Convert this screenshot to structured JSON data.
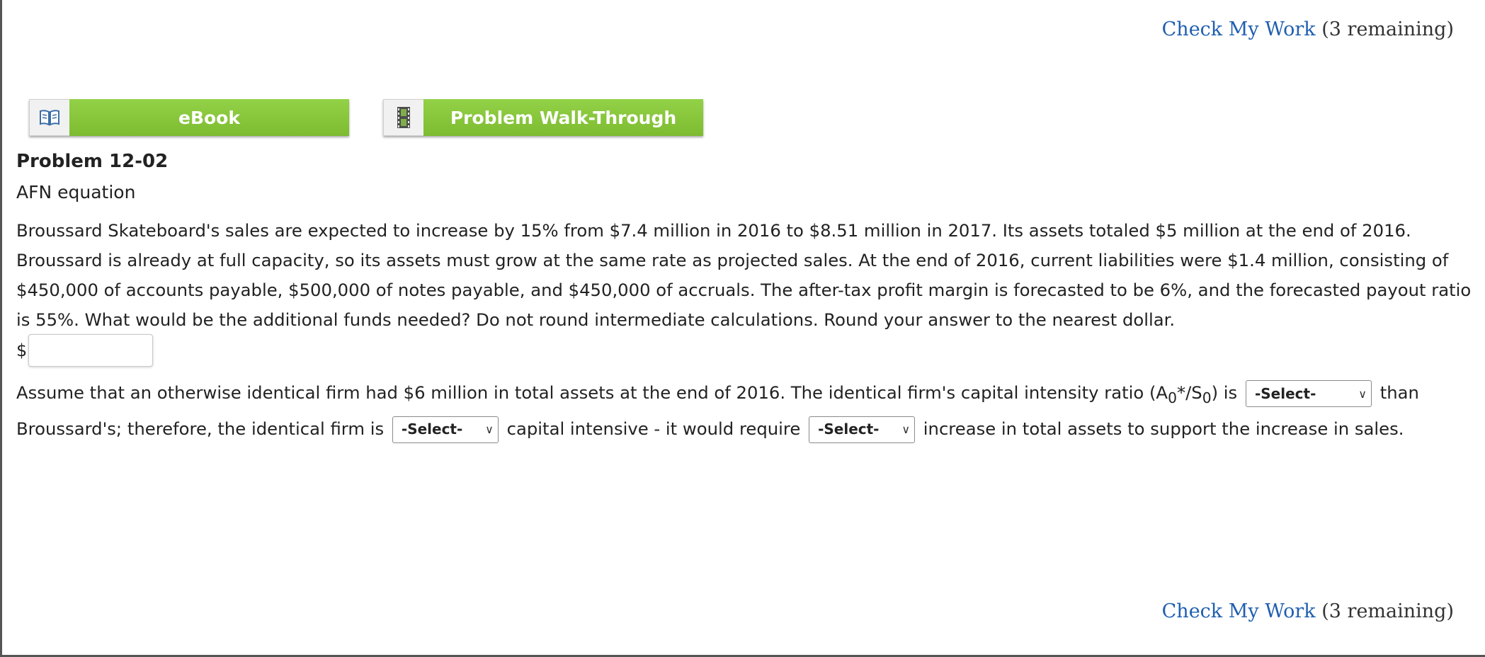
{
  "check_my_work": {
    "link": "Check My Work",
    "remaining": "(3 remaining)"
  },
  "buttons": {
    "ebook": "eBook",
    "walkthrough": "Problem Walk-Through"
  },
  "problem": {
    "title": "Problem 12-02",
    "subtitle": "AFN equation",
    "text": "Broussard Skateboard's sales are expected to increase by 15% from $7.4 million in 2016 to $8.51 million in 2017. Its assets totaled $5 million at the end of 2016. Broussard is already at full capacity, so its assets must grow at the same rate as projected sales. At the end of 2016, current liabilities were $1.4 million, consisting of $450,000 of accounts payable, $500,000 of notes payable, and $450,000 of accruals. The after-tax profit margin is forecasted to be 6%, and the forecasted payout ratio is 55%. What would be the additional funds needed? Do not round intermediate calculations. Round your answer to the nearest dollar.",
    "currency_symbol": "$",
    "answer_value": ""
  },
  "followup": {
    "part1": "Assume that an otherwise identical firm had $6 million in total assets at the end of 2016. The identical firm's capital intensity ratio (A",
    "sub0_a": "0",
    "part2": "*/S",
    "sub0_b": "0",
    "part3": ") is",
    "part4": "than Broussard's; therefore, the identical firm is",
    "part5": "capital intensive - it would require",
    "part6": "increase in total assets to support the increase in sales.",
    "select_placeholder": "-Select-"
  },
  "icons": {
    "ebook": "book-icon",
    "walkthrough": "film-icon",
    "dropdown": "chevron-down-icon"
  },
  "colors": {
    "button_green": "#7dbb30",
    "link_blue": "#1f5fb0"
  }
}
